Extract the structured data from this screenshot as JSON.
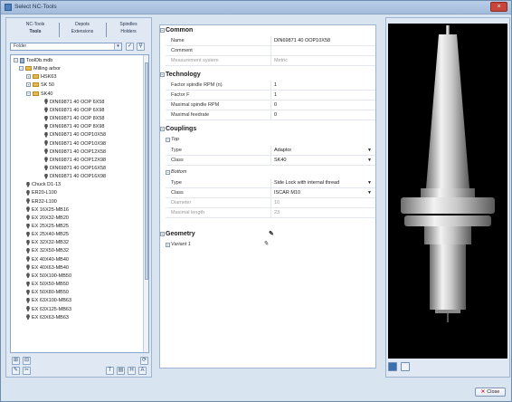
{
  "window": {
    "title": "Select NC-Tools",
    "close_glyph": "×"
  },
  "tabs": {
    "row1": [
      "NC-Tools",
      "Depots",
      "Spindles"
    ],
    "row2": [
      "Tools",
      "Extensions",
      "Holders"
    ]
  },
  "filter": {
    "value": "Folder"
  },
  "tree": {
    "root": "ToolDb.mdb",
    "group": "Milling arbor",
    "folders": [
      "HSK63",
      "SK 50",
      "SK40"
    ],
    "sk40_items": [
      "DIN69871 40 OOP 6X58",
      "DIN69871 40 OOP 6X98",
      "DIN69871 40 OOP 8X58",
      "DIN69871 40 OOP 8X98",
      "DIN69871 40 OOP10X58",
      "DIN69871 40 OOP10X98",
      "DIN69871 40 OOP12X58",
      "DIN69871 40 OOP12X98",
      "DIN69871 40 OOP16X58",
      "DIN69871 40 OOP16X98"
    ],
    "other_items": [
      "Chuck D1-13",
      "ER20-L100",
      "ER32-L100",
      "EX 16X25-MB16",
      "EX 20X32-MB20",
      "EX 25X25-MB25",
      "EX 25X40-MB25",
      "EX 32X32-MB32",
      "EX 32X50-MB32",
      "EX 40X40-MB40",
      "EX 40X63-MB40",
      "EX 50X100-MB50",
      "EX 50X50-MB50",
      "EX 50X80-MB50",
      "EX 63X100-MB63",
      "EX 63X125-MB63",
      "EX 63X63-MB63"
    ]
  },
  "properties": {
    "common": {
      "title": "Common",
      "rows": [
        {
          "name": "Name",
          "value": "DIN69871 40 OOP10X58"
        },
        {
          "name": "Comment",
          "value": ""
        },
        {
          "name": "Measurement system",
          "value": "Metric"
        }
      ]
    },
    "technology": {
      "title": "Technology",
      "rows": [
        {
          "name": "Factor spindle RPM (n)",
          "value": "1"
        },
        {
          "name": "Factor F",
          "value": "1"
        },
        {
          "name": "Maximal spindle RPM",
          "value": "0"
        },
        {
          "name": "Maximal feedrate",
          "value": "0"
        }
      ]
    },
    "couplings": {
      "title": "Couplings",
      "top": {
        "title": "Top",
        "rows": [
          {
            "name": "Type",
            "value": "Adaptor"
          },
          {
            "name": "Class",
            "value": "SK40"
          }
        ]
      },
      "bottom": {
        "title": "Bottom",
        "rows": [
          {
            "name": "Type",
            "value": "Side Lock with internal thread"
          },
          {
            "name": "Class",
            "value": "ISCAR M10"
          },
          {
            "name": "Diameter",
            "value": "10"
          },
          {
            "name": "Maximal length",
            "value": "23"
          }
        ]
      }
    },
    "geometry": {
      "title": "Geometry",
      "variant": "Variant 1"
    }
  },
  "footer": {
    "close_label": "Close"
  },
  "colors": {
    "accent": "#4f7fbf",
    "preview_bg": "#000000",
    "tool_metal": "#cfcfcf"
  }
}
